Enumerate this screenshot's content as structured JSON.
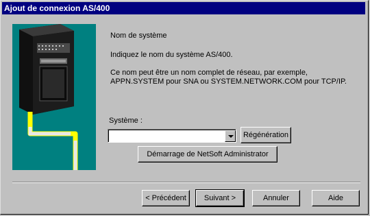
{
  "window": {
    "title": "Ajout de connexion AS/400"
  },
  "content": {
    "heading": "Nom de système",
    "instruction": "Indiquez le nom du système AS/400.",
    "description_line1": "Ce nom peut être un nom complet de réseau, par exemple,",
    "description_line2": "APPN.SYSTEM pour SNA ou SYSTEM.NETWORK.COM pour TCP/IP.",
    "system_label": "Système :",
    "system_value": ""
  },
  "buttons": {
    "regenerate": "Régénération",
    "netsoft": "Démarrage de NetSoft Administrator",
    "previous": "< Précédent",
    "next": "Suivant >",
    "cancel": "Annuler",
    "help": "Aide"
  },
  "colors": {
    "titlebar": "#000080",
    "illustration_bg": "#008080",
    "cable": "#ffff00"
  }
}
